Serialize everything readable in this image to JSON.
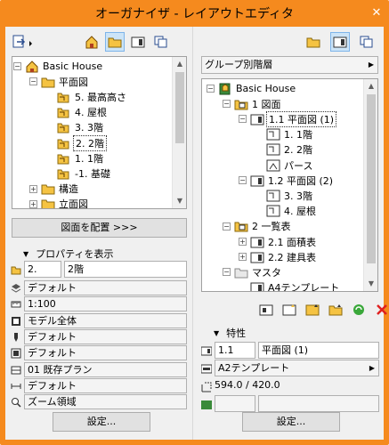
{
  "window": {
    "title": "オーガナイザ - レイアウトエディタ",
    "close_glyph": "✕"
  },
  "left": {
    "tree": [
      {
        "label": "Basic House",
        "icon": "house-icon",
        "depth": 0,
        "exp": "-"
      },
      {
        "label": "平面図",
        "icon": "folder-icon",
        "depth": 1,
        "exp": "-"
      },
      {
        "label": "5. 最高高さ",
        "icon": "story-icon",
        "depth": 2
      },
      {
        "label": "4. 屋根",
        "icon": "story-icon",
        "depth": 2
      },
      {
        "label": "3. 3階",
        "icon": "story-icon",
        "depth": 2
      },
      {
        "label": "2. 2階",
        "icon": "story-icon",
        "depth": 2,
        "selected": true
      },
      {
        "label": "1. 1階",
        "icon": "story-icon",
        "depth": 2
      },
      {
        "label": "-1. 基礎",
        "icon": "story-icon",
        "depth": 2
      },
      {
        "label": "構造",
        "icon": "folder-icon",
        "depth": 1,
        "exp": "+"
      },
      {
        "label": "立面図",
        "icon": "folder-icon",
        "depth": 1,
        "exp": "+"
      }
    ],
    "place_button": "図面を配置 >>>",
    "props_header": "プロパティを表示",
    "id_field": "2.",
    "name_field": "2階",
    "props": [
      {
        "icon": "layer-icon",
        "value": "デフォルト"
      },
      {
        "icon": "scale-icon",
        "value": "1:100"
      },
      {
        "icon": "model-icon",
        "value": "モデル全体"
      },
      {
        "icon": "pen-icon",
        "value": "デフォルト"
      },
      {
        "icon": "display-icon",
        "value": "デフォルト"
      },
      {
        "icon": "renovation-icon",
        "value": "01 既存プラン"
      },
      {
        "icon": "dimension-icon",
        "value": "デフォルト"
      },
      {
        "icon": "zoom-icon",
        "value": "ズーム領域"
      }
    ],
    "settings_button": "設定..."
  },
  "right": {
    "dropdown": "グループ別階層",
    "tree": [
      {
        "label": "Basic House",
        "icon": "book-icon",
        "depth": 0,
        "exp": "-"
      },
      {
        "label": "1 図面",
        "icon": "subset-icon",
        "depth": 1,
        "exp": "-"
      },
      {
        "label": "1.1 平面図 (1)",
        "icon": "layout-icon",
        "depth": 2,
        "exp": "-",
        "selected": true
      },
      {
        "label": "1. 1階",
        "icon": "drawing-icon",
        "depth": 3
      },
      {
        "label": "2. 2階",
        "icon": "drawing-icon",
        "depth": 3
      },
      {
        "label": "パース",
        "icon": "camera-icon",
        "depth": 3
      },
      {
        "label": "1.2 平面図 (2)",
        "icon": "layout-icon",
        "depth": 2,
        "exp": "-"
      },
      {
        "label": "3. 3階",
        "icon": "drawing-icon",
        "depth": 3
      },
      {
        "label": "4. 屋根",
        "icon": "drawing-icon",
        "depth": 3
      },
      {
        "label": "2 一覧表",
        "icon": "subset-icon",
        "depth": 1,
        "exp": "-"
      },
      {
        "label": "2.1 面積表",
        "icon": "layout-icon",
        "depth": 2,
        "exp": "+"
      },
      {
        "label": "2.2 建具表",
        "icon": "layout-icon",
        "depth": 2,
        "exp": "+"
      },
      {
        "label": "マスタ",
        "icon": "master-folder-icon",
        "depth": 1,
        "exp": "-"
      },
      {
        "label": "A4テンプレート",
        "icon": "layout-icon",
        "depth": 2
      }
    ],
    "props_header": "特性",
    "id_field": "1.1",
    "name_field": "平面図 (1)",
    "template": "A2テンプレート",
    "size": "594.0 / 420.0",
    "settings_button": "設定..."
  },
  "colors": {
    "title_bar": "#f58a1e",
    "selection": "#cce4f7",
    "folder": "#f5c342",
    "delete": "#e02020"
  }
}
